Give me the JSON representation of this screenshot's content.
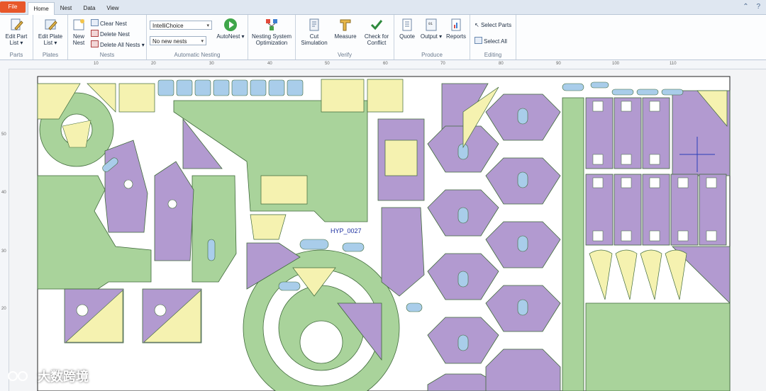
{
  "tabs": [
    "File",
    "Home",
    "Nest",
    "Data",
    "View"
  ],
  "ribbon": {
    "parts": {
      "edit_part_list": "Edit Part List",
      "label": "Parts"
    },
    "plates": {
      "edit_plate_list": "Edit Plate List",
      "label": "Plates"
    },
    "nests": {
      "new_nest": "New Nest",
      "clear_nest": "Clear Nest",
      "delete_nest": "Delete Nest",
      "delete_all_nests": "Delete All Nests",
      "label": "Nests"
    },
    "automatic_nesting": {
      "strategy_value": "IntelliChoice",
      "nests_value": "No new nests",
      "autonest": "AutoNest",
      "nesting_system_optimization": "Nesting System Optimization",
      "label": "Automatic Nesting"
    },
    "verify": {
      "cut_simulation": "Cut Simulation",
      "measure": "Measure",
      "check_for_conflict": "Check for Conflict",
      "label": "Verify"
    },
    "produce": {
      "quote": "Quote",
      "output": "Output",
      "reports": "Reports",
      "label": "Produce"
    },
    "editing": {
      "select_parts": "Select Parts",
      "select_all": "Select All",
      "label": "Editing"
    }
  },
  "ruler": {
    "top": [
      "10",
      "20",
      "30",
      "40",
      "50",
      "60",
      "70",
      "80",
      "90",
      "100",
      "110"
    ],
    "left": [
      "50",
      "40",
      "30",
      "20"
    ]
  },
  "nest": {
    "part_label": "HYP_0027"
  },
  "colors": {
    "green": "#a9d39b",
    "purple": "#b29ad0",
    "yellow": "#f5f2b0",
    "blue": "#a9cdea",
    "outline": "#3f6a3a"
  },
  "watermark": "大数跨境"
}
